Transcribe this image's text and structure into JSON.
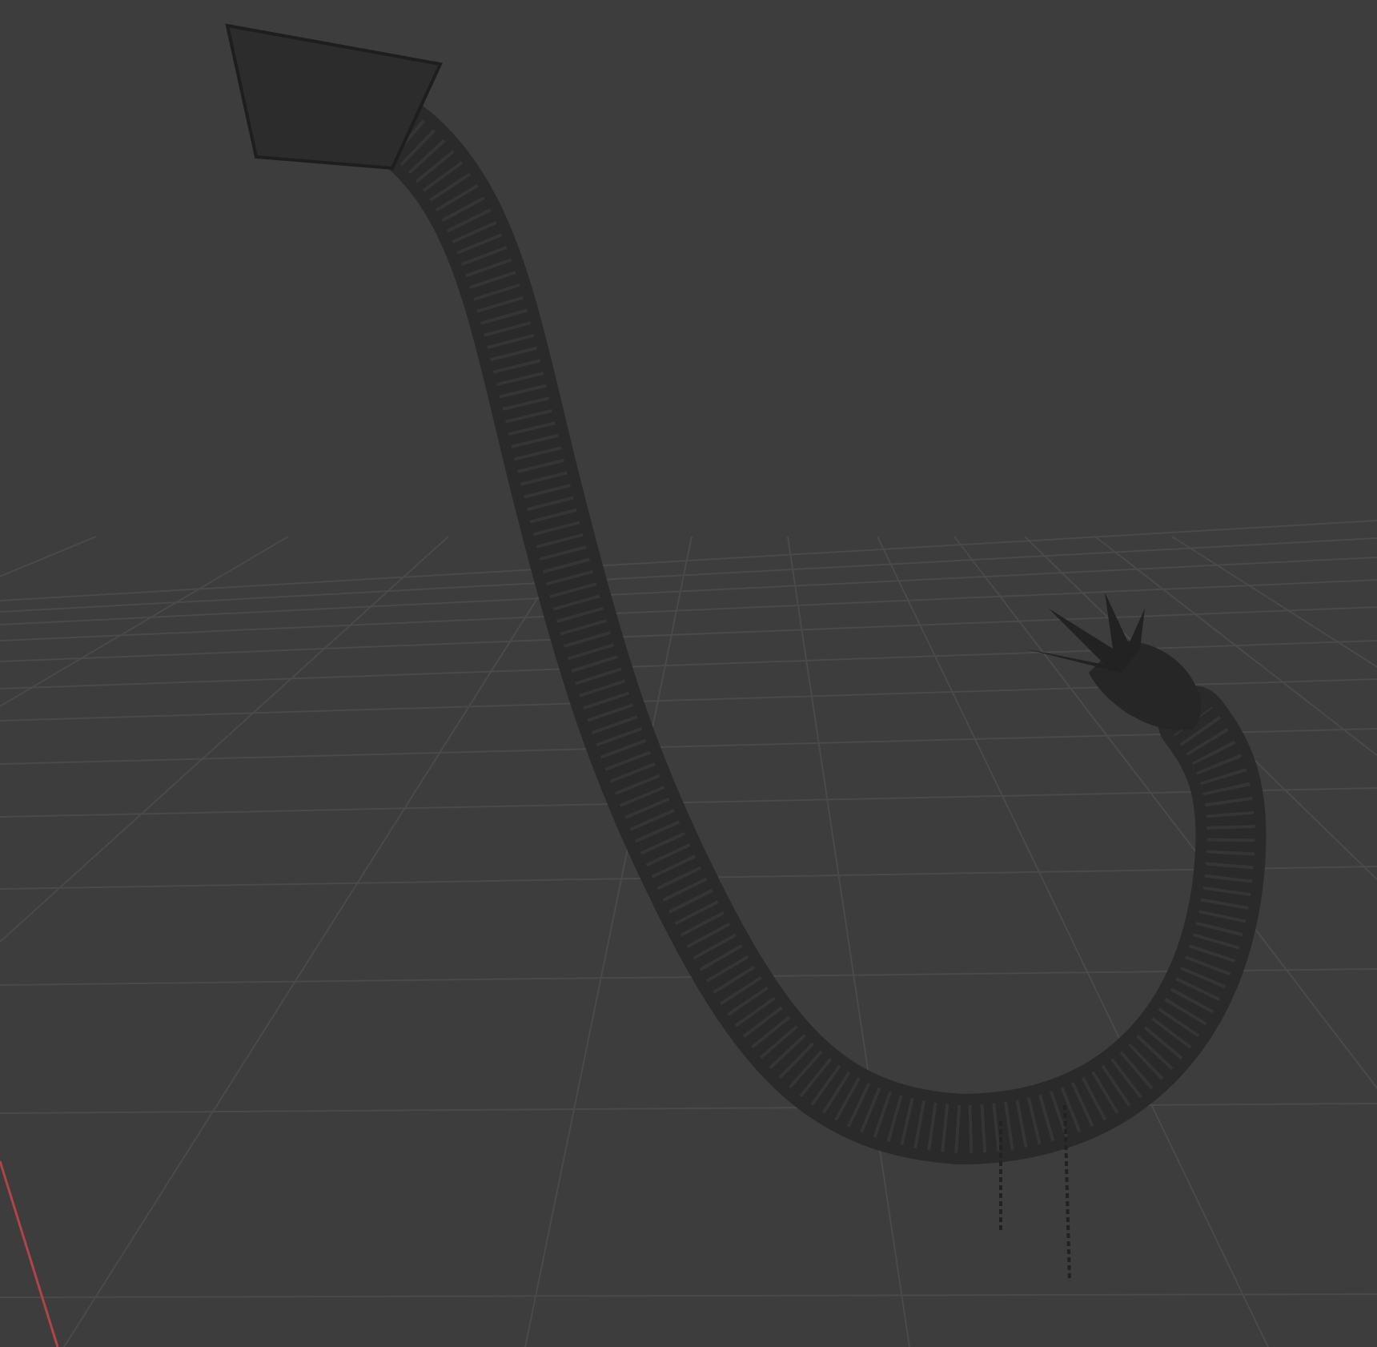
{
  "viewport": {
    "grid_visible": true,
    "x_axis_visible": true
  }
}
